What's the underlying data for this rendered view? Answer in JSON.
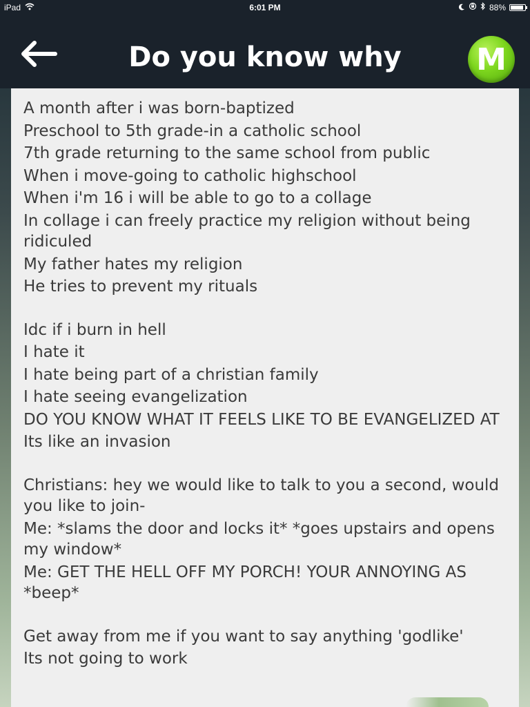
{
  "status_bar": {
    "device": "iPad",
    "time": "6:01 PM",
    "battery": "88%",
    "battery_level": 0.88
  },
  "header": {
    "title": "Do you know why",
    "back_icon": "arrow-left-icon",
    "badge_letter": "M",
    "badge_color": "#7dd61e"
  },
  "post": {
    "paragraphs": [
      [
        "A month after i was born-baptized",
        "Preschool to 5th grade-in a catholic school",
        "7th grade returning to the same school from public",
        "When i move-going to catholic highschool",
        "When i'm 16 i will be able to go to a collage",
        "In collage i can freely practice my religion without being ridiculed",
        "My father hates my religion",
        "He tries to prevent my rituals"
      ],
      [
        "Idc if i burn in hell",
        "I hate it",
        "I hate being part of a christian family",
        "I hate seeing evangelization",
        "DO YOU KNOW WHAT IT FEELS LIKE TO BE EVANGELIZED AT",
        "Its like an invasion"
      ],
      [
        "Christians: hey we would like to talk to you a second, would you like to join-",
        "Me: *slams the door and locks it* *goes upstairs and opens my window*",
        "Me: GET THE HELL OFF MY PORCH! YOUR ANNOYING AS *beep*"
      ],
      [
        "Get away from me if you want to say anything 'godlike'",
        "Its not going to work"
      ]
    ]
  }
}
